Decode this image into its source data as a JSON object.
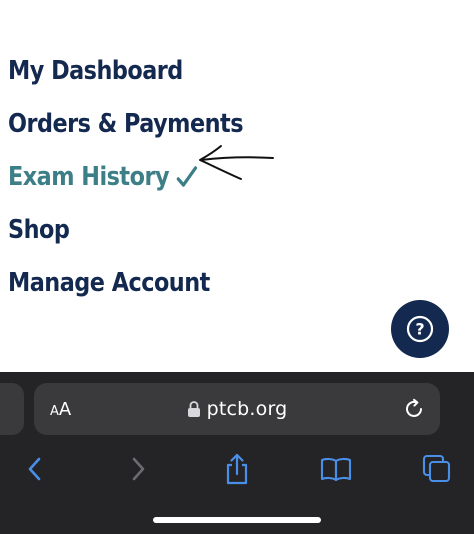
{
  "theme": {
    "navy": "#14294f",
    "accent": "#3d7f87",
    "browser_bg": "#242427",
    "pill_bg": "#3a3a3d",
    "toolbar_blue": "#4a8fe7",
    "toolbar_disabled": "#6b6b70"
  },
  "nav": {
    "items": [
      {
        "label": "My Dashboard",
        "active": false
      },
      {
        "label": "Orders & Payments",
        "active": false
      },
      {
        "label": "Exam History",
        "active": true
      },
      {
        "label": "Shop",
        "active": false
      },
      {
        "label": "Manage Account",
        "active": false
      }
    ]
  },
  "help": {
    "symbol": "?"
  },
  "browser": {
    "aa_small": "A",
    "aa_large": "A",
    "url": "ptcb.org",
    "icons": {
      "lock": "lock-icon",
      "reload": "reload-icon",
      "back": "chevron-left-icon",
      "forward": "chevron-right-icon",
      "share": "share-icon",
      "bookmarks": "book-icon",
      "tabs": "tabs-icon"
    }
  }
}
